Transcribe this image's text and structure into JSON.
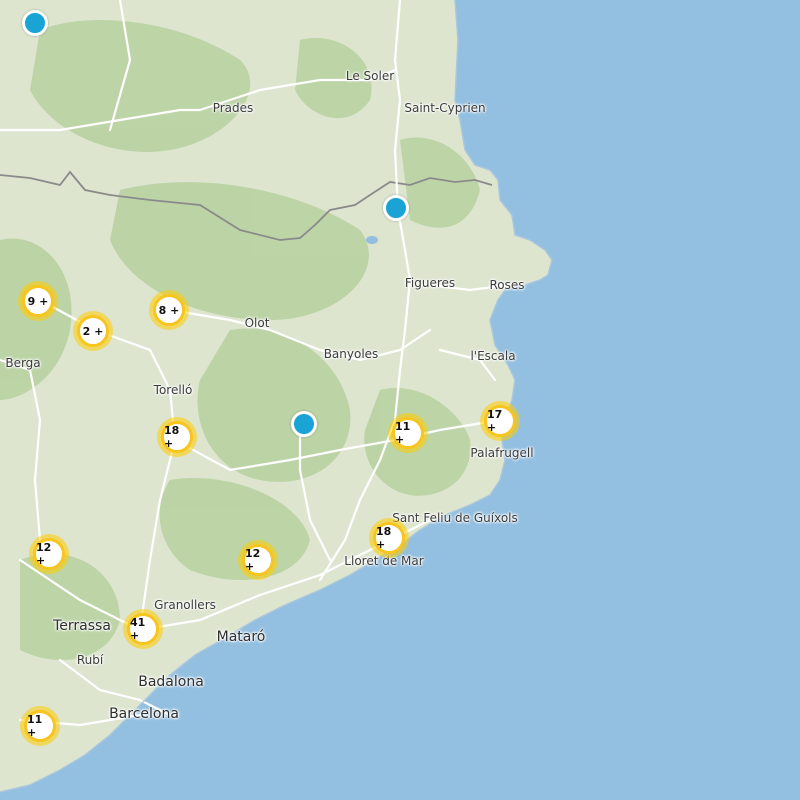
{
  "map": {
    "colors": {
      "sea": "#93bfe0",
      "land": "#dde5cf",
      "forest": "#b3cf9c",
      "road": "#ffffff",
      "border": "#888888",
      "cluster_ring": "#f7c51e",
      "marker": "#1aa4d6"
    },
    "places": [
      {
        "id": "le-soler",
        "label": "Le Soler"
      },
      {
        "id": "prades",
        "label": "Prades"
      },
      {
        "id": "saint-cyprien",
        "label": "Saint-Cyprien"
      },
      {
        "id": "figueres",
        "label": "Figueres"
      },
      {
        "id": "roses",
        "label": "Roses"
      },
      {
        "id": "olot",
        "label": "Olot"
      },
      {
        "id": "banyoles",
        "label": "Banyoles"
      },
      {
        "id": "lescala",
        "label": "l'Escala"
      },
      {
        "id": "berga",
        "label": "Berga"
      },
      {
        "id": "torello",
        "label": "Torelló"
      },
      {
        "id": "palafrugell",
        "label": "Palafrugell"
      },
      {
        "id": "sant-feliu",
        "label": "Sant Feliu de Guíxols"
      },
      {
        "id": "lloret",
        "label": "Lloret de Mar"
      },
      {
        "id": "granollers",
        "label": "Granollers"
      },
      {
        "id": "terrassa",
        "label": "Terrassa"
      },
      {
        "id": "mataro",
        "label": "Mataró"
      },
      {
        "id": "rubi",
        "label": "Rubí"
      },
      {
        "id": "badalona",
        "label": "Badalona"
      },
      {
        "id": "barcelona",
        "label": "Barcelona"
      }
    ],
    "clusters": [
      {
        "id": "c1",
        "label": "9 +"
      },
      {
        "id": "c2",
        "label": "2 +"
      },
      {
        "id": "c3",
        "label": "8 +"
      },
      {
        "id": "c4",
        "label": "18 +"
      },
      {
        "id": "c5",
        "label": "11 +"
      },
      {
        "id": "c6",
        "label": "17 +"
      },
      {
        "id": "c7",
        "label": "18 +"
      },
      {
        "id": "c8",
        "label": "12 +"
      },
      {
        "id": "c9",
        "label": "12 +"
      },
      {
        "id": "c10",
        "label": "41 +"
      },
      {
        "id": "c11",
        "label": "11 +"
      }
    ],
    "markers": [
      {
        "id": "m1"
      },
      {
        "id": "m2"
      },
      {
        "id": "m3"
      }
    ]
  }
}
